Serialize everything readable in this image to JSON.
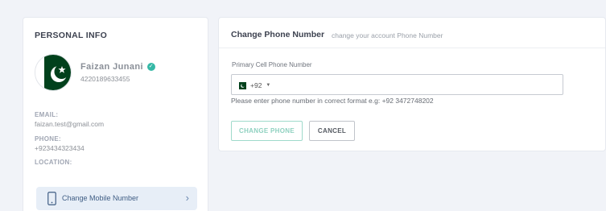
{
  "profile": {
    "section_title": "PERSONAL INFO",
    "avatar_icon": "pakistan-flag",
    "name": "Faizan Junani",
    "id_number": "4220189633455",
    "email_label": "EMAIL:",
    "email": "faizan.test@gmail.com",
    "phone_label": "PHONE:",
    "phone": "+923434323434",
    "location_label": "LOCATION:",
    "change_mobile_label": "Change Mobile Number",
    "change_mobile_icon": "mobile-phone-icon"
  },
  "change_phone": {
    "title": "Change Phone Number",
    "subtitle": "change your account Phone Number",
    "input_label": "Primary Cell Phone Number",
    "country_code": "+92",
    "country_flag": "pakistan-flag",
    "phone_value": "",
    "helper_text": "Please enter phone number in correct format e.g: +92 3472748202",
    "submit_label": "CHANGE PHONE",
    "cancel_label": "CANCEL"
  },
  "colors": {
    "accent_teal": "#35b8a6",
    "flag_green": "#01411c",
    "button_bg": "#e7eef7"
  }
}
